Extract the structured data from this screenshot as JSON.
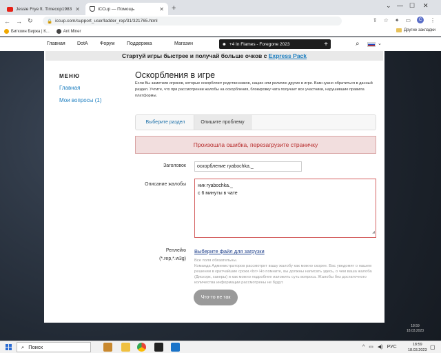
{
  "browser": {
    "tabs": [
      {
        "title": "Jessie Frye ft. Timecop1983"
      },
      {
        "title": "iCCup — Помощь"
      }
    ],
    "url": "iccup.com/support_user/ladder_rep/31/321765.html",
    "profile_initial": "C",
    "bookmarks": [
      "Биткоин Биржа | К...",
      "Ant Miner"
    ],
    "other_bookmarks": "Другие закладки"
  },
  "nav": {
    "links": [
      "Главная",
      "DotA",
      "Форум",
      "Поддержка",
      "Магазин"
    ],
    "banner": "+4  In Flames - Foregone 2023"
  },
  "promo": {
    "text": "Стартуй игры быстрее и получай больше очков с ",
    "link": "Express Pack"
  },
  "sidebar": {
    "heading": "МЕНЮ",
    "items": [
      "Главная",
      "Мои вопросы (1)"
    ]
  },
  "main": {
    "title": "Оскорбления в игре",
    "intro": "Если Вы заметили игроков, которые оскорбляют родственников, нацию или религию других в игре. Вам нужно обратиться в данный раздел. Учтите, что при рассмотрении жалобы на оскорбления, блокировку чата получает все участники, нарушившие правила платформы.",
    "tabs": [
      "Выберите раздел",
      "Опишите проблему"
    ],
    "error": "Произошла ошибка, перезагрузите страничку",
    "form": {
      "title_label": "Заголовок",
      "title_value": "оскорбление ryabochka._",
      "desc_label": "Описание жалобы",
      "desc_lines": [
        "ник ryabochka._",
        "с 6 минуты в чате"
      ],
      "replay_label": "Реплейю",
      "replay_ext": "(*.rep,*.w3g)",
      "file_link": "Выберите файл для загрузки",
      "note_lines": [
        "Все поля обязательны.",
        "Команда Администраторов рассмотрит вашу жалобу как можно скорее. Вас уведомят о нашем решении в кратчайшие сроки.<br> Но помните, вы должны написать здесь, о чем ваша жалоба (Дискорк, хакеры) и как можно подробнее изложить суть вопроса. Жалобы без достаточного количества информации рассмотрены не будут."
      ],
      "submit": "Что-то не так"
    }
  },
  "taskbar": {
    "search": "Поиск",
    "lang": "РУС",
    "time": "18:59",
    "date": "18.03.2023"
  }
}
